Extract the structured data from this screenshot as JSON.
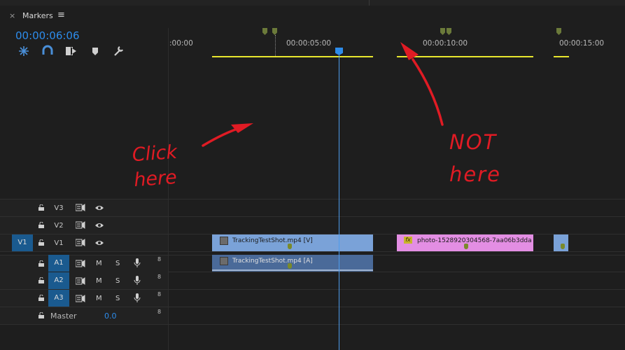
{
  "panel": {
    "title": "Markers",
    "close_icon": "×",
    "menu_icon": "≡"
  },
  "timecode": "00:00:06:06",
  "ruler": {
    "labels": [
      ":00:00",
      "00:00:05:00",
      "00:00:10:00",
      "00:00:15:00"
    ]
  },
  "tracks": {
    "video": [
      {
        "name": "V3",
        "source": ""
      },
      {
        "name": "V2",
        "source": ""
      },
      {
        "name": "V1",
        "source": "V1"
      }
    ],
    "audio": [
      {
        "name": "A1",
        "m": "M",
        "s": "S",
        "vol": "8"
      },
      {
        "name": "A2",
        "m": "M",
        "s": "S",
        "vol": "8"
      },
      {
        "name": "A3",
        "m": "M",
        "s": "S",
        "vol": "8"
      }
    ],
    "master": {
      "label": "Master",
      "value": "0.0",
      "vol": "8"
    }
  },
  "clips": {
    "v1_tracking": "TrackingTestShot.mp4 [V]",
    "a1_tracking": "TrackingTestShot.mp4 [A]",
    "photo": "photo-1528920304568-7aa06b3dda8b.j",
    "fx_label": "fx"
  },
  "annotations": {
    "click_here": "Click here",
    "not_here": "NOT here",
    "color": "#e01b24"
  },
  "colors": {
    "timecode": "#2d8ceb",
    "video_clip": "#7aa2d8",
    "audio_clip": "#4a6a99",
    "photo_clip": "#e38ee3",
    "work_area": "#e8e62e",
    "marker": "#6b7a3a"
  }
}
